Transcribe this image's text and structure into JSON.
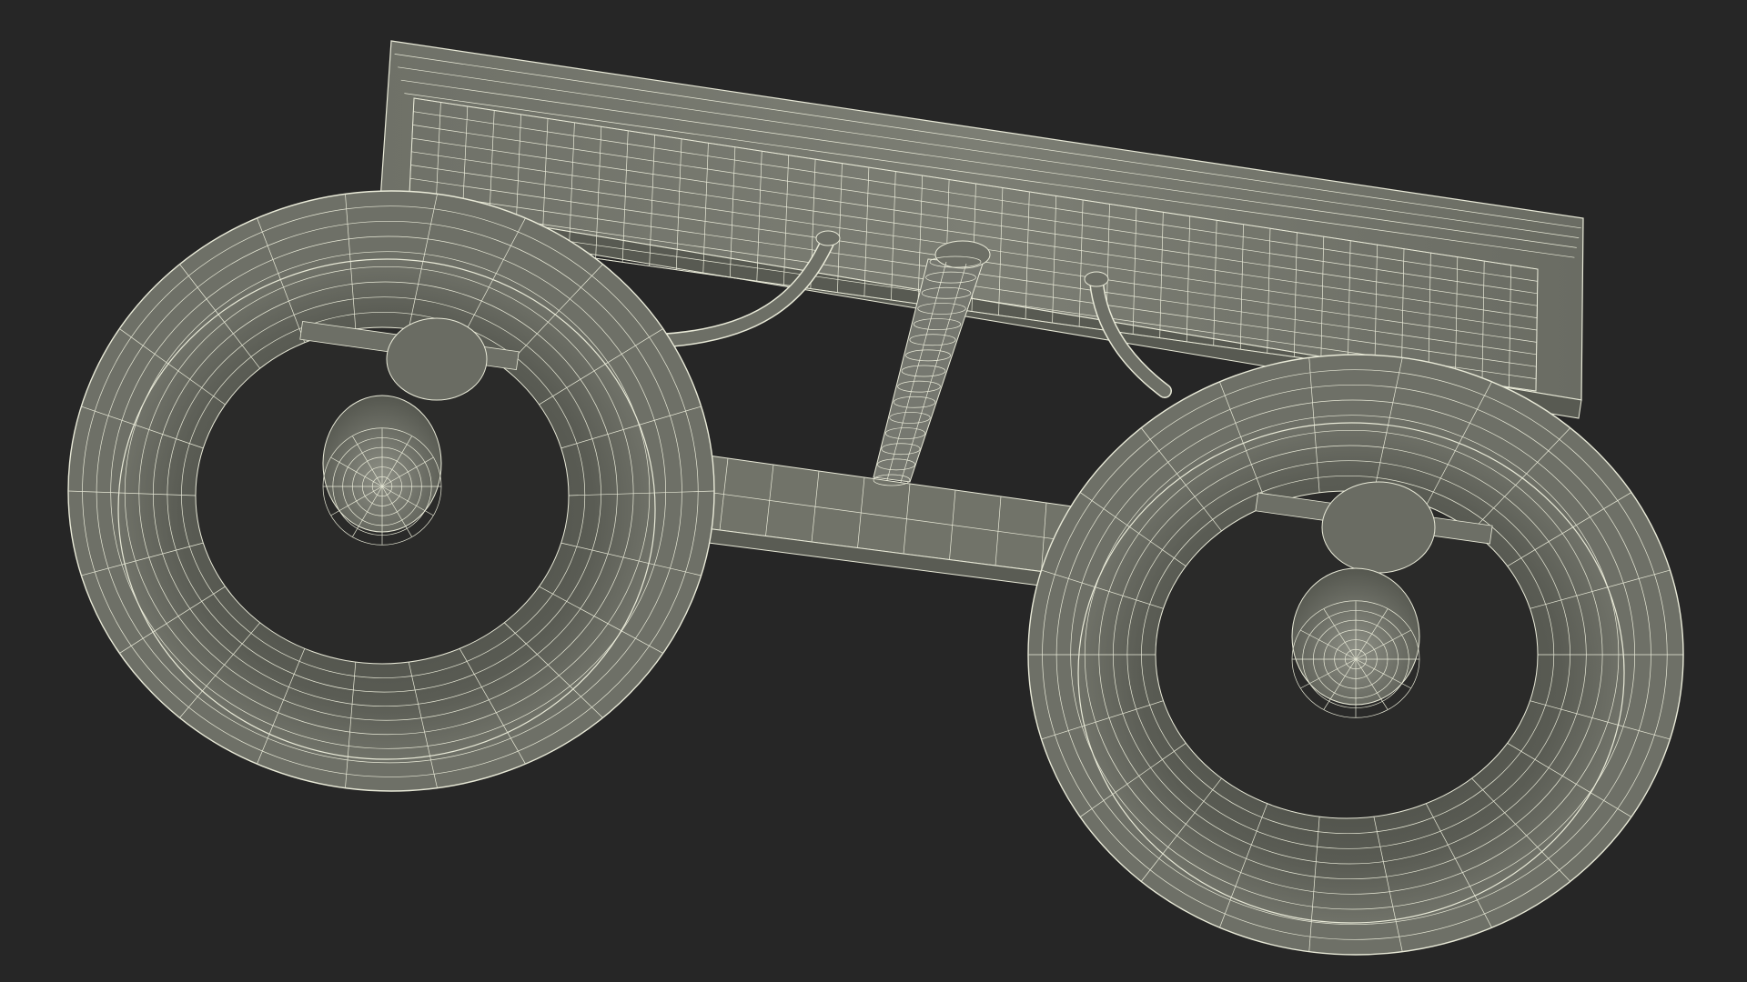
{
  "scene": {
    "subject": "wireframe-render",
    "colors": {
      "background": "#262626",
      "mesh_fill": "#6b6d64",
      "mesh_fill_dark": "#4a4c45",
      "mesh_fill_light": "#8a8c82",
      "wire": "#e9ead8"
    },
    "objects": [
      {
        "name": "wall-backplate"
      },
      {
        "name": "crossbar-arm"
      },
      {
        "name": "center-stem"
      },
      {
        "name": "left-curved-arm"
      },
      {
        "name": "right-curved-arm"
      },
      {
        "name": "left-bell-shade"
      },
      {
        "name": "left-bulb-socket"
      },
      {
        "name": "right-bell-shade"
      },
      {
        "name": "right-bulb-socket"
      }
    ]
  }
}
